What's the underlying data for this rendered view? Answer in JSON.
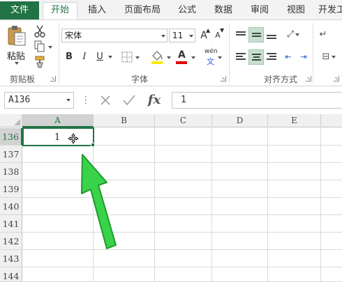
{
  "tabs": {
    "file": "文件",
    "items": [
      "开始",
      "插入",
      "页面布局",
      "公式",
      "数据",
      "审阅",
      "视图",
      "开发工"
    ],
    "active": "开始"
  },
  "ribbon": {
    "clipboard": {
      "paste_label": "粘贴",
      "group_label": "剪贴板"
    },
    "font": {
      "font_name": "宋体",
      "font_size": "11",
      "bold": "B",
      "italic": "I",
      "underline": "U",
      "font_color_glyph": "A",
      "phonetic_top": "wén",
      "phonetic_bottom": "文",
      "grow_glyph": "A",
      "shrink_glyph": "A",
      "group_label": "字体"
    },
    "alignment": {
      "group_label": "对齐方式"
    }
  },
  "formula_bar": {
    "name_box": "A136",
    "fx_label": "fx",
    "value": "1",
    "dots": "⋮"
  },
  "grid": {
    "columns": [
      "A",
      "B",
      "C",
      "D",
      "E"
    ],
    "selected_column": "A",
    "rows": [
      "136",
      "137",
      "138",
      "139",
      "140",
      "141",
      "142",
      "143",
      "144"
    ],
    "selected_row": "136",
    "active_cell": {
      "ref": "A136",
      "value": "1"
    }
  },
  "colors": {
    "accent": "#217346",
    "arrow_fill": "#39d34a",
    "arrow_stroke": "#1d9b2c"
  },
  "icons": [
    "cut-icon",
    "copy-icon",
    "format-painter-icon",
    "paste-icon",
    "fill-color-icon",
    "font-color-icon",
    "border-icon",
    "cancel-icon",
    "enter-icon",
    "move-cursor-icon"
  ]
}
